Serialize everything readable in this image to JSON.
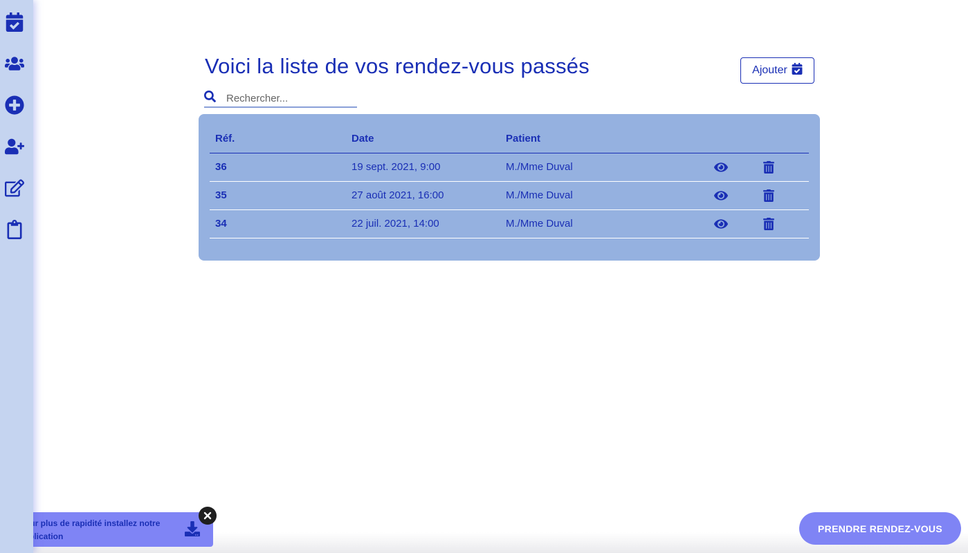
{
  "sidebar": {
    "items": [
      {
        "icon": "calendar-check-icon"
      },
      {
        "icon": "users-icon"
      },
      {
        "icon": "plus-circle-icon"
      },
      {
        "icon": "user-plus-icon"
      },
      {
        "icon": "edit-icon"
      },
      {
        "icon": "clipboard-icon"
      }
    ]
  },
  "main": {
    "title": "Voici la liste de vos rendez-vous passés",
    "add_label": "Ajouter",
    "search_placeholder": "Rechercher..."
  },
  "table": {
    "headers": {
      "ref": "Réf.",
      "date": "Date",
      "patient": "Patient"
    },
    "rows": [
      {
        "ref": "36",
        "date": "19 sept. 2021, 9:00",
        "patient": "M./Mme Duval"
      },
      {
        "ref": "35",
        "date": "27 août 2021, 16:00",
        "patient": "M./Mme Duval"
      },
      {
        "ref": "34",
        "date": "22 juil. 2021, 14:00",
        "patient": "M./Mme Duval"
      }
    ]
  },
  "install_banner": {
    "text": "Pour plus de rapidité installez notre application"
  },
  "cta_label": "PRENDRE RENDEZ-VOUS",
  "colors": {
    "accent": "#1a2fb5",
    "sidebar": "#c5d4f0",
    "table_bg": "#95b1e0",
    "button_bg": "#7f84f5"
  }
}
